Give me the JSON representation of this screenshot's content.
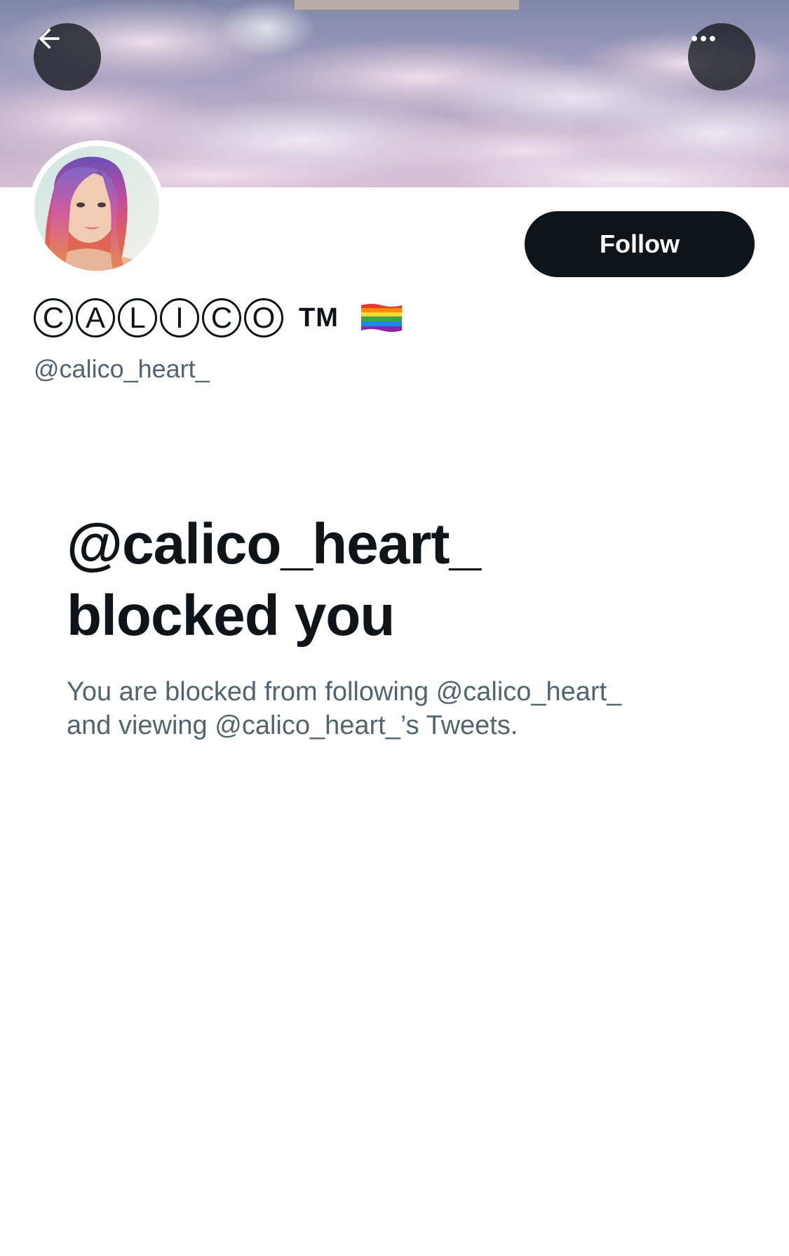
{
  "header": {
    "back_icon": "arrow-left-icon",
    "more_icon": "more-horizontal-icon"
  },
  "profile": {
    "display_name_letters": [
      "C",
      "A",
      "L",
      "I",
      "C",
      "O"
    ],
    "trademark": "TM",
    "flag_icon": "rainbow-flag-icon",
    "handle": "@calico_heart_",
    "follow_label": "Follow"
  },
  "blocked": {
    "title_line1": "@calico_heart_",
    "title_line2": "blocked you",
    "description_line1": "You are blocked from following @calico_heart_",
    "description_line2": "and viewing @calico_heart_’s Tweets."
  },
  "colors": {
    "primary_text": "#0f1419",
    "secondary_text": "#536471",
    "button_bg": "#0f1419",
    "button_text": "#ffffff"
  }
}
